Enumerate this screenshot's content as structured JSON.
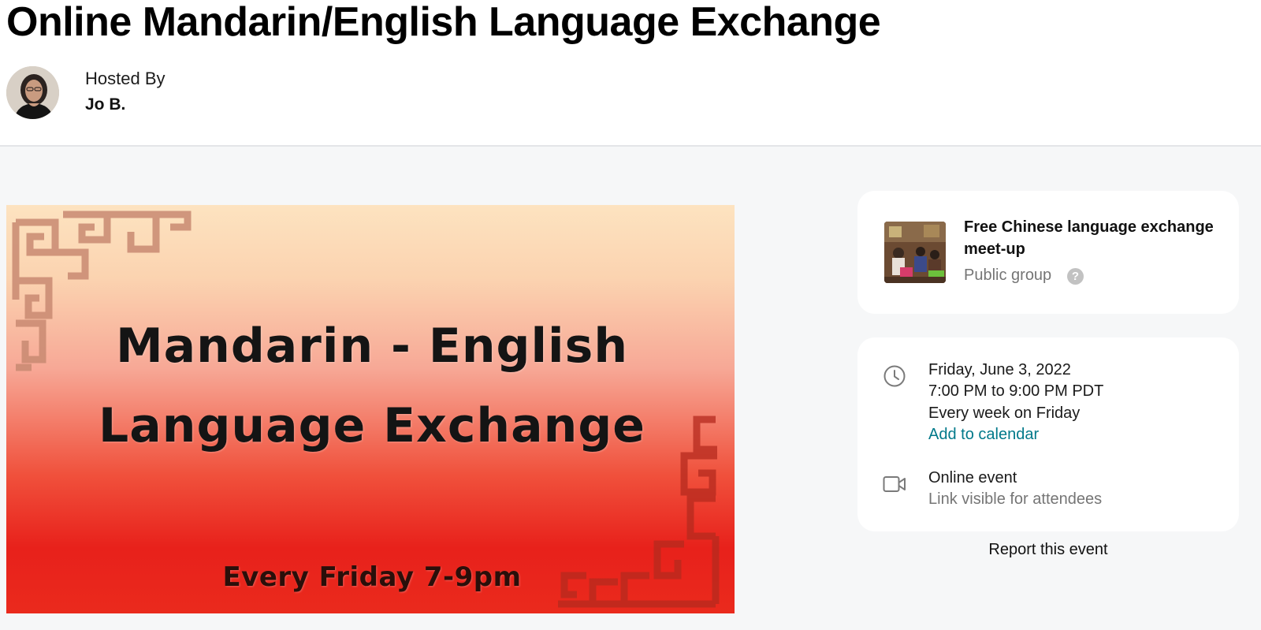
{
  "event": {
    "title": "Online Mandarin/English Language Exchange",
    "hosted_by_label": "Hosted By",
    "host_name": "Jo B."
  },
  "banner": {
    "line1": "Mandarin - English",
    "line2": "Language Exchange",
    "line3": "Every Friday 7-9pm"
  },
  "group": {
    "name": "Free Chinese language exchange meet-up",
    "type": "Public group",
    "help_icon": "question-circle-icon"
  },
  "details": {
    "date": "Friday, June 3, 2022",
    "time": "7:00 PM to 9:00 PM PDT",
    "recurrence": "Every week on Friday",
    "add_to_calendar": "Add to calendar",
    "location_type": "Online event",
    "location_note": "Link visible for attendees"
  },
  "report_label": "Report this event",
  "colors": {
    "link": "#00798a",
    "muted_text": "#757575",
    "page_background": "#f6f7f8",
    "banner_top": "#fde3c0",
    "banner_bottom": "#e8211b"
  }
}
